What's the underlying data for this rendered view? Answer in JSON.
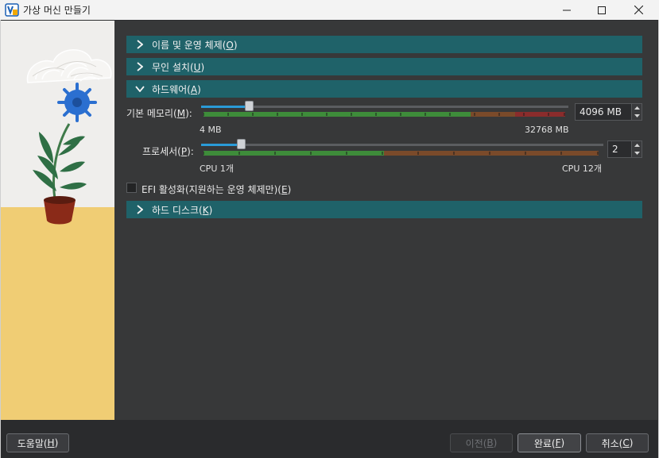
{
  "window": {
    "title": "가상 머신 만들기",
    "minimize": "minimize",
    "maximize": "maximize",
    "close": "close"
  },
  "sections": {
    "os": {
      "label": "이름 및 운영 체제(O)",
      "text": "이름 및 운영 체제(",
      "key": "O",
      "end": ")",
      "expanded": false
    },
    "unattended": {
      "label": "무인 설치(U)",
      "text": "무인 설치(",
      "key": "U",
      "end": ")",
      "expanded": false
    },
    "hardware": {
      "label": "하드웨어(A)",
      "text": "하드웨어(",
      "key": "A",
      "end": ")",
      "expanded": true
    },
    "disk": {
      "label": "하드 디스크(K)",
      "text": "하드 디스크(",
      "key": "K",
      "end": ")",
      "expanded": false
    }
  },
  "hardware": {
    "memory": {
      "label_text": "기본 메모리(",
      "label_key": "M",
      "label_end": "):",
      "value": "4096 MB",
      "min_label": "4 MB",
      "max_label": "32768 MB",
      "min": 4,
      "max": 32768,
      "current": 4096,
      "safe_fraction": 0.75,
      "warn_fraction": 0.87
    },
    "processors": {
      "label_text": "프로세서(",
      "label_key": "P",
      "label_end": "):",
      "value": "2",
      "min_label": "CPU 1개",
      "max_label": "CPU 12개",
      "min": 1,
      "max": 12,
      "current": 2,
      "safe_fraction": 0.45
    },
    "efi": {
      "label_text": "EFI 활성화(지원하는 운영 체제만)(",
      "label_key": "E",
      "label_end": ")",
      "checked": false
    }
  },
  "footer": {
    "help": {
      "text": "도움말(",
      "key": "H",
      "end": ")"
    },
    "back": {
      "text": "이전(",
      "key": "B",
      "end": ")",
      "enabled": false
    },
    "finish": {
      "text": "완료(",
      "key": "F",
      "end": ")"
    },
    "cancel": {
      "text": "취소(",
      "key": "C",
      "end": ")"
    }
  },
  "colors": {
    "section_bg": "#1f6269",
    "safe": "#3e8c3a",
    "warn": "#7a4a2a",
    "danger": "#8a2c2c",
    "slider_fill": "#2a9bd8"
  }
}
